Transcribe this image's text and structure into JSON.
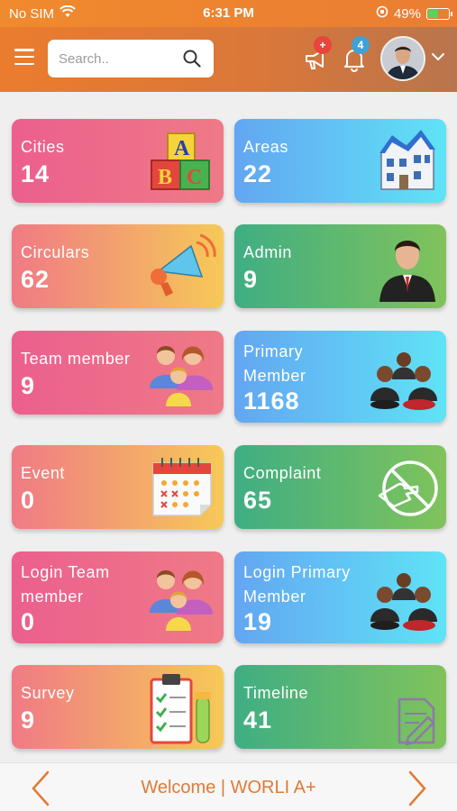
{
  "status": {
    "carrier": "No SIM",
    "time": "6:31 PM",
    "battery": "49%",
    "battery_level": 0.49
  },
  "header": {
    "search_placeholder": "Search..",
    "notification_badge": "4",
    "announcement_badge": "+"
  },
  "cards": [
    {
      "label": "Cities",
      "value": "14",
      "icon": "abc-blocks-icon"
    },
    {
      "label": "Areas",
      "value": "22",
      "icon": "building-icon"
    },
    {
      "label": "Circulars",
      "value": "62",
      "icon": "megaphone-icon"
    },
    {
      "label": "Admin",
      "value": "9",
      "icon": "admin-user-icon"
    },
    {
      "label": "Team member",
      "value": "9",
      "icon": "family-group-icon"
    },
    {
      "label": "Primary\nMember",
      "value": "1168",
      "icon": "member-group-icon"
    },
    {
      "label": "Event",
      "value": "0",
      "icon": "calendar-icon"
    },
    {
      "label": "Complaint",
      "value": "65",
      "icon": "complaint-hand-icon"
    },
    {
      "label": "Login Team\nmember",
      "value": "0",
      "icon": "family-group-icon"
    },
    {
      "label": "Login Primary\nMember",
      "value": "19",
      "icon": "member-group-icon"
    },
    {
      "label": "Survey",
      "value": "9",
      "icon": "clipboard-checklist-icon"
    },
    {
      "label": "Timeline",
      "value": "41",
      "icon": "timeline-document-icon"
    }
  ],
  "footer": {
    "welcome": "Welcome | WORLI A+"
  },
  "colors": {
    "accent": "#ea7c2e",
    "footer_text": "#e07a35"
  }
}
